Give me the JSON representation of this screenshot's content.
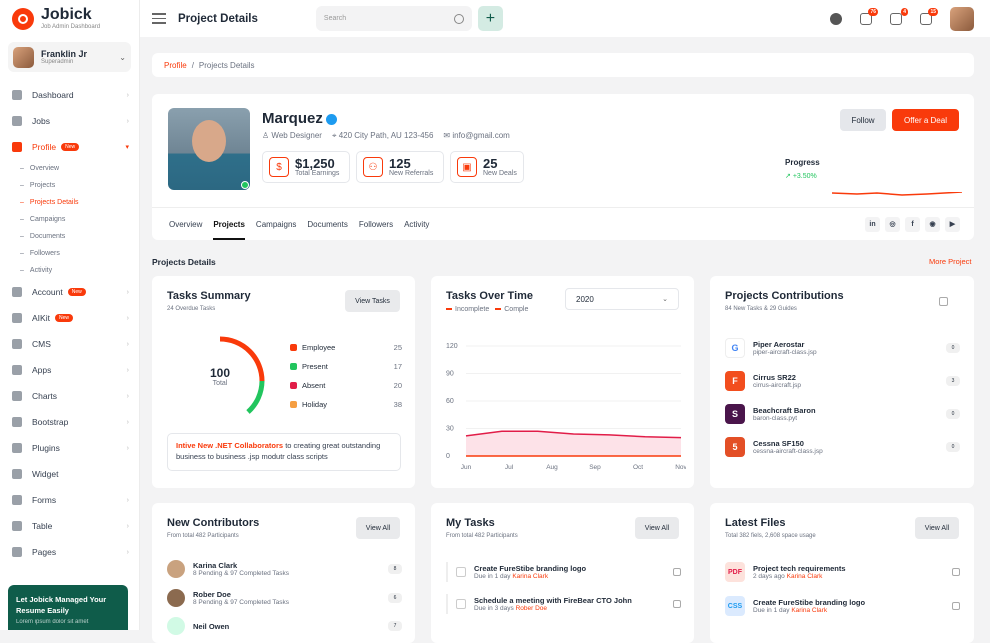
{
  "brand": {
    "name": "Jobick",
    "subtitle": "Job Admin Dashboard"
  },
  "user": {
    "name": "Franklin Jr",
    "role": "Superadmin"
  },
  "sidebar": {
    "items": [
      {
        "label": "Dashboard"
      },
      {
        "label": "Jobs"
      },
      {
        "label": "Profile",
        "badge": "New"
      }
    ],
    "sub": [
      "Overview",
      "Projects",
      "Projects Details",
      "Campaigns",
      "Documents",
      "Followers",
      "Activity"
    ],
    "items2": [
      {
        "label": "Account",
        "badge": "New"
      },
      {
        "label": "AIKit",
        "badge": "New"
      },
      {
        "label": "CMS"
      },
      {
        "label": "Apps"
      },
      {
        "label": "Charts"
      },
      {
        "label": "Bootstrap"
      },
      {
        "label": "Plugins"
      },
      {
        "label": "Widget"
      },
      {
        "label": "Forms"
      },
      {
        "label": "Table"
      },
      {
        "label": "Pages"
      }
    ],
    "promo": {
      "title": "Let Jobick Managed Your Resume Easily",
      "text": "Lorem ipsum dolor sit amet"
    }
  },
  "header": {
    "title": "Project Details",
    "search_placeholder": "Search",
    "badges": [
      "76",
      "4",
      "15"
    ]
  },
  "breadcrumb": {
    "root": "Profile",
    "sep": "/",
    "current": "Projects Details"
  },
  "profile": {
    "name": "Marquez",
    "role": "Web Designer",
    "address": "420 City Path, AU 123-456",
    "email": "info@gmail.com",
    "stats": [
      {
        "value": "$1,250",
        "label": "Total Earnings"
      },
      {
        "value": "125",
        "label": "New Referrals"
      },
      {
        "value": "25",
        "label": "New Deals"
      }
    ],
    "follow": "Follow",
    "offer": "Offer a Deal",
    "progress_label": "Progress",
    "progress_value": "+3.50%",
    "tabs": [
      "Overview",
      "Projects",
      "Campaigns",
      "Documents",
      "Followers",
      "Activity"
    ],
    "socials": [
      "in",
      "◎",
      "f",
      "◉",
      "▶"
    ]
  },
  "section": {
    "title": "Projects Details",
    "link": "More Project"
  },
  "tasks_summary": {
    "title": "Tasks Summary",
    "sub": "24 Overdue Tasks",
    "button": "View Tasks",
    "total": "100",
    "total_label": "Total",
    "legend": [
      {
        "label": "Employee",
        "value": "25",
        "color": "#f93a0b"
      },
      {
        "label": "Present",
        "value": "17",
        "color": "#22c55e"
      },
      {
        "label": "Absent",
        "value": "20",
        "color": "#e11d48"
      },
      {
        "label": "Holiday",
        "value": "38",
        "color": "#f59e42"
      }
    ],
    "note_bold": "Intive New .NET Collaborators",
    "note_text": " to creating great outstanding business to business .jsp modutr class scripts"
  },
  "tasks_time": {
    "title": "Tasks Over Time",
    "legend": [
      "Incomplete",
      "Comple"
    ],
    "year": "2020"
  },
  "chart_data": {
    "type": "area",
    "x": [
      "Jun",
      "Jul",
      "Aug",
      "Sep",
      "Oct",
      "Nov"
    ],
    "yticks": [
      "120",
      "90",
      "60",
      "30",
      "0"
    ],
    "ylim": [
      0,
      120
    ],
    "series": [
      {
        "name": "Incomplete",
        "values": [
          22,
          27,
          27,
          24,
          23,
          21,
          20
        ]
      },
      {
        "name": "Comple",
        "values": [
          0,
          0,
          0,
          0,
          0,
          0,
          0
        ]
      }
    ]
  },
  "contributions": {
    "title": "Projects Contributions",
    "sub": "84 New Tasks & 29 Guides",
    "items": [
      {
        "name": "Piper Aerostar",
        "file": "piper-aircraft-class.jsp",
        "count": "0",
        "logo": "G"
      },
      {
        "name": "Cirrus SR22",
        "file": "cirrus-aircraft.jsp",
        "count": "3",
        "logo": "F"
      },
      {
        "name": "Beachcraft Baron",
        "file": "baron-class.pyt",
        "count": "0",
        "logo": "S"
      },
      {
        "name": "Cessna SF150",
        "file": "cessna-aircraft-class.jsp",
        "count": "0",
        "logo": "5"
      }
    ]
  },
  "contributors": {
    "title": "New Contributors",
    "sub": "From total 482 Participants",
    "button": "View All",
    "items": [
      {
        "name": "Karina Clark",
        "text": "8 Pending & 97 Completed Tasks",
        "count": "8"
      },
      {
        "name": "Rober Doe",
        "text": "8 Pending & 97 Completed Tasks",
        "count": "6"
      },
      {
        "name": "Neil Owen",
        "text": "",
        "count": "7"
      }
    ]
  },
  "my_tasks": {
    "title": "My Tasks",
    "sub": "From total 482 Participants",
    "button": "View All",
    "items": [
      {
        "name": "Create FureStibe branding logo",
        "due": "Due in 1 day",
        "who": "Karina Clark"
      },
      {
        "name": "Schedule a meeting with FireBear CTO John",
        "due": "Due in 3 days",
        "who": "Rober Doe"
      }
    ]
  },
  "files": {
    "title": "Latest Files",
    "sub": "Total 382 fiels, 2,608 space usage",
    "button": "View All",
    "items": [
      {
        "name": "Project tech requirements",
        "due": "2 days ago",
        "who": "Karina Clark"
      },
      {
        "name": "Create FureStibe branding logo",
        "due": "Due in 1 day",
        "who": "Karina Clark"
      }
    ]
  }
}
